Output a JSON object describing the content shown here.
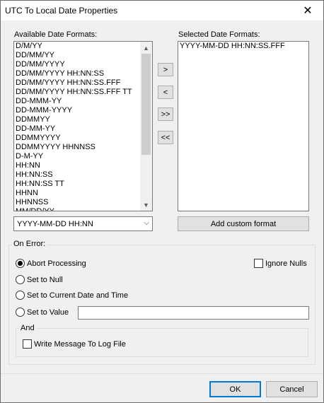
{
  "window": {
    "title": "UTC To Local Date Properties"
  },
  "available": {
    "label": "Available Date Formats:",
    "items": [
      "D/M/YY",
      "DD/MM/YY",
      "DD/MM/YYYY",
      "DD/MM/YYYY HH:NN:SS",
      "DD/MM/YYYY HH:NN:SS.FFF",
      "DD/MM/YYYY HH:NN:SS.FFF TT",
      "DD-MMM-YY",
      "DD-MMM-YYYY",
      "DDMMYY",
      "DD-MM-YY",
      "DDMMYYYY",
      "DDMMYYYY HHNNSS",
      "D-M-YY",
      "HH:NN",
      "HH:NN:SS",
      "HH:NN:SS TT",
      "HHNN",
      "HHNNSS",
      "MM/DD/YY"
    ],
    "combo_value": "YYYY-MM-DD HH:NN"
  },
  "selected": {
    "label": "Selected Date Formats:",
    "items": [
      "YYYY-MM-DD HH:NN:SS.FFF"
    ],
    "add_custom_label": "Add custom format"
  },
  "move_buttons": {
    "add": ">",
    "remove": "<",
    "add_all": ">>",
    "remove_all": "<<"
  },
  "on_error": {
    "label": "On Error:",
    "options": [
      "Abort Processing",
      "Set to Null",
      "Set to Current Date and Time",
      "Set to Value"
    ],
    "selected_index": 0,
    "ignore_nulls_label": "Ignore Nulls",
    "ignore_nulls_checked": false,
    "value_text": ""
  },
  "and_group": {
    "label": "And",
    "write_log_label": "Write Message To Log File",
    "write_log_checked": false
  },
  "footer": {
    "ok_label": "OK",
    "cancel_label": "Cancel"
  }
}
